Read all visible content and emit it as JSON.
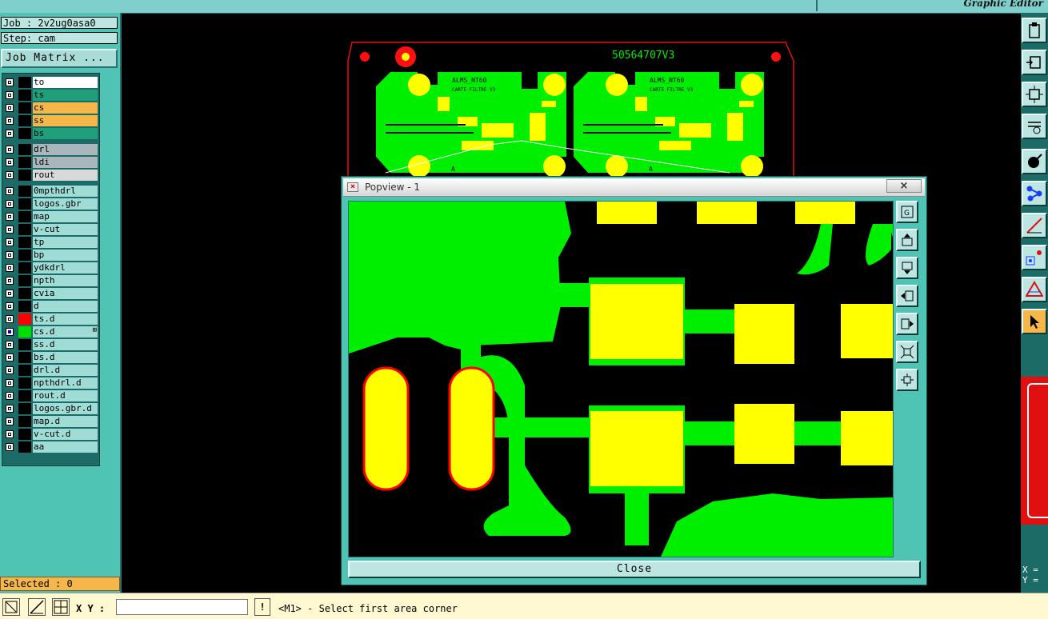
{
  "topbar": {
    "brand": "Graphic Editor"
  },
  "job": {
    "job_label": "Job : 2v2ug0asa0",
    "step_label": "Step: cam",
    "matrix_button": "Job Matrix ..."
  },
  "layers": [
    {
      "name": "to",
      "color": "#ffffff",
      "swatch": "#000000"
    },
    {
      "name": "ts",
      "color": "#1fa07a",
      "swatch": "#000000"
    },
    {
      "name": "cs",
      "color": "#f5b74a",
      "swatch": "#000000"
    },
    {
      "name": "ss",
      "color": "#f5b74a",
      "swatch": "#000000"
    },
    {
      "name": "bs",
      "color": "#1fa07a",
      "swatch": "#000000"
    },
    {
      "name": "drl",
      "color": "#a9b7bd",
      "swatch": "#000000"
    },
    {
      "name": "ldi",
      "color": "#a9b7bd",
      "swatch": "#000000"
    },
    {
      "name": "rout",
      "color": "#d9d9d9",
      "swatch": "#000000"
    },
    {
      "name": "0mpthdrl",
      "color": "#9fdcd6",
      "swatch": "#000000"
    },
    {
      "name": "logos.gbr",
      "color": "#9fdcd6",
      "swatch": "#000000"
    },
    {
      "name": "map",
      "color": "#9fdcd6",
      "swatch": "#000000"
    },
    {
      "name": "v-cut",
      "color": "#9fdcd6",
      "swatch": "#000000"
    },
    {
      "name": "tp",
      "color": "#9fdcd6",
      "swatch": "#000000"
    },
    {
      "name": "bp",
      "color": "#9fdcd6",
      "swatch": "#000000"
    },
    {
      "name": "ydkdrl",
      "color": "#9fdcd6",
      "swatch": "#000000"
    },
    {
      "name": "npth",
      "color": "#9fdcd6",
      "swatch": "#000000"
    },
    {
      "name": "cvia",
      "color": "#9fdcd6",
      "swatch": "#000000"
    },
    {
      "name": "d",
      "color": "#9fdcd6",
      "swatch": "#000000"
    },
    {
      "name": "ts.d",
      "color": "#9fdcd6",
      "swatch": "#ff0000"
    },
    {
      "name": "cs.d",
      "color": "#9fdcd6",
      "swatch": "#00dd00",
      "active": true,
      "mark": "⊞"
    },
    {
      "name": "ss.d",
      "color": "#9fdcd6",
      "swatch": "#000000"
    },
    {
      "name": "bs.d",
      "color": "#9fdcd6",
      "swatch": "#000000"
    },
    {
      "name": "drl.d",
      "color": "#9fdcd6",
      "swatch": "#000000"
    },
    {
      "name": "npthdrl.d",
      "color": "#9fdcd6",
      "swatch": "#000000"
    },
    {
      "name": "rout.d",
      "color": "#9fdcd6",
      "swatch": "#000000"
    },
    {
      "name": "logos.gbr.d",
      "color": "#9fdcd6",
      "swatch": "#000000"
    },
    {
      "name": "map.d",
      "color": "#9fdcd6",
      "swatch": "#000000"
    },
    {
      "name": "v-cut.d",
      "color": "#9fdcd6",
      "swatch": "#000000"
    },
    {
      "name": "aa",
      "color": "#9fdcd6",
      "swatch": "#000000"
    }
  ],
  "selected_label": "Selected : 0",
  "status": {
    "xy_label": "X Y :",
    "xy_value": "",
    "message": "<M1> - Select first area corner",
    "warn_icon": "!"
  },
  "board": {
    "part_number": "50564707V3",
    "label_top": "ALMS_NT60",
    "label_sub": "CARTE FILTRE V3",
    "marker": "A"
  },
  "popup": {
    "title": "Popview - 1",
    "close_x": "×",
    "close_button": "Close"
  },
  "right_readout": {
    "x": "X =",
    "y": "Y ="
  },
  "colors": {
    "copper": "#00ee00",
    "pad": "#ffff00",
    "outline": "#ff0000",
    "panel": "#4fc4b4",
    "dark": "#1d6b66"
  }
}
